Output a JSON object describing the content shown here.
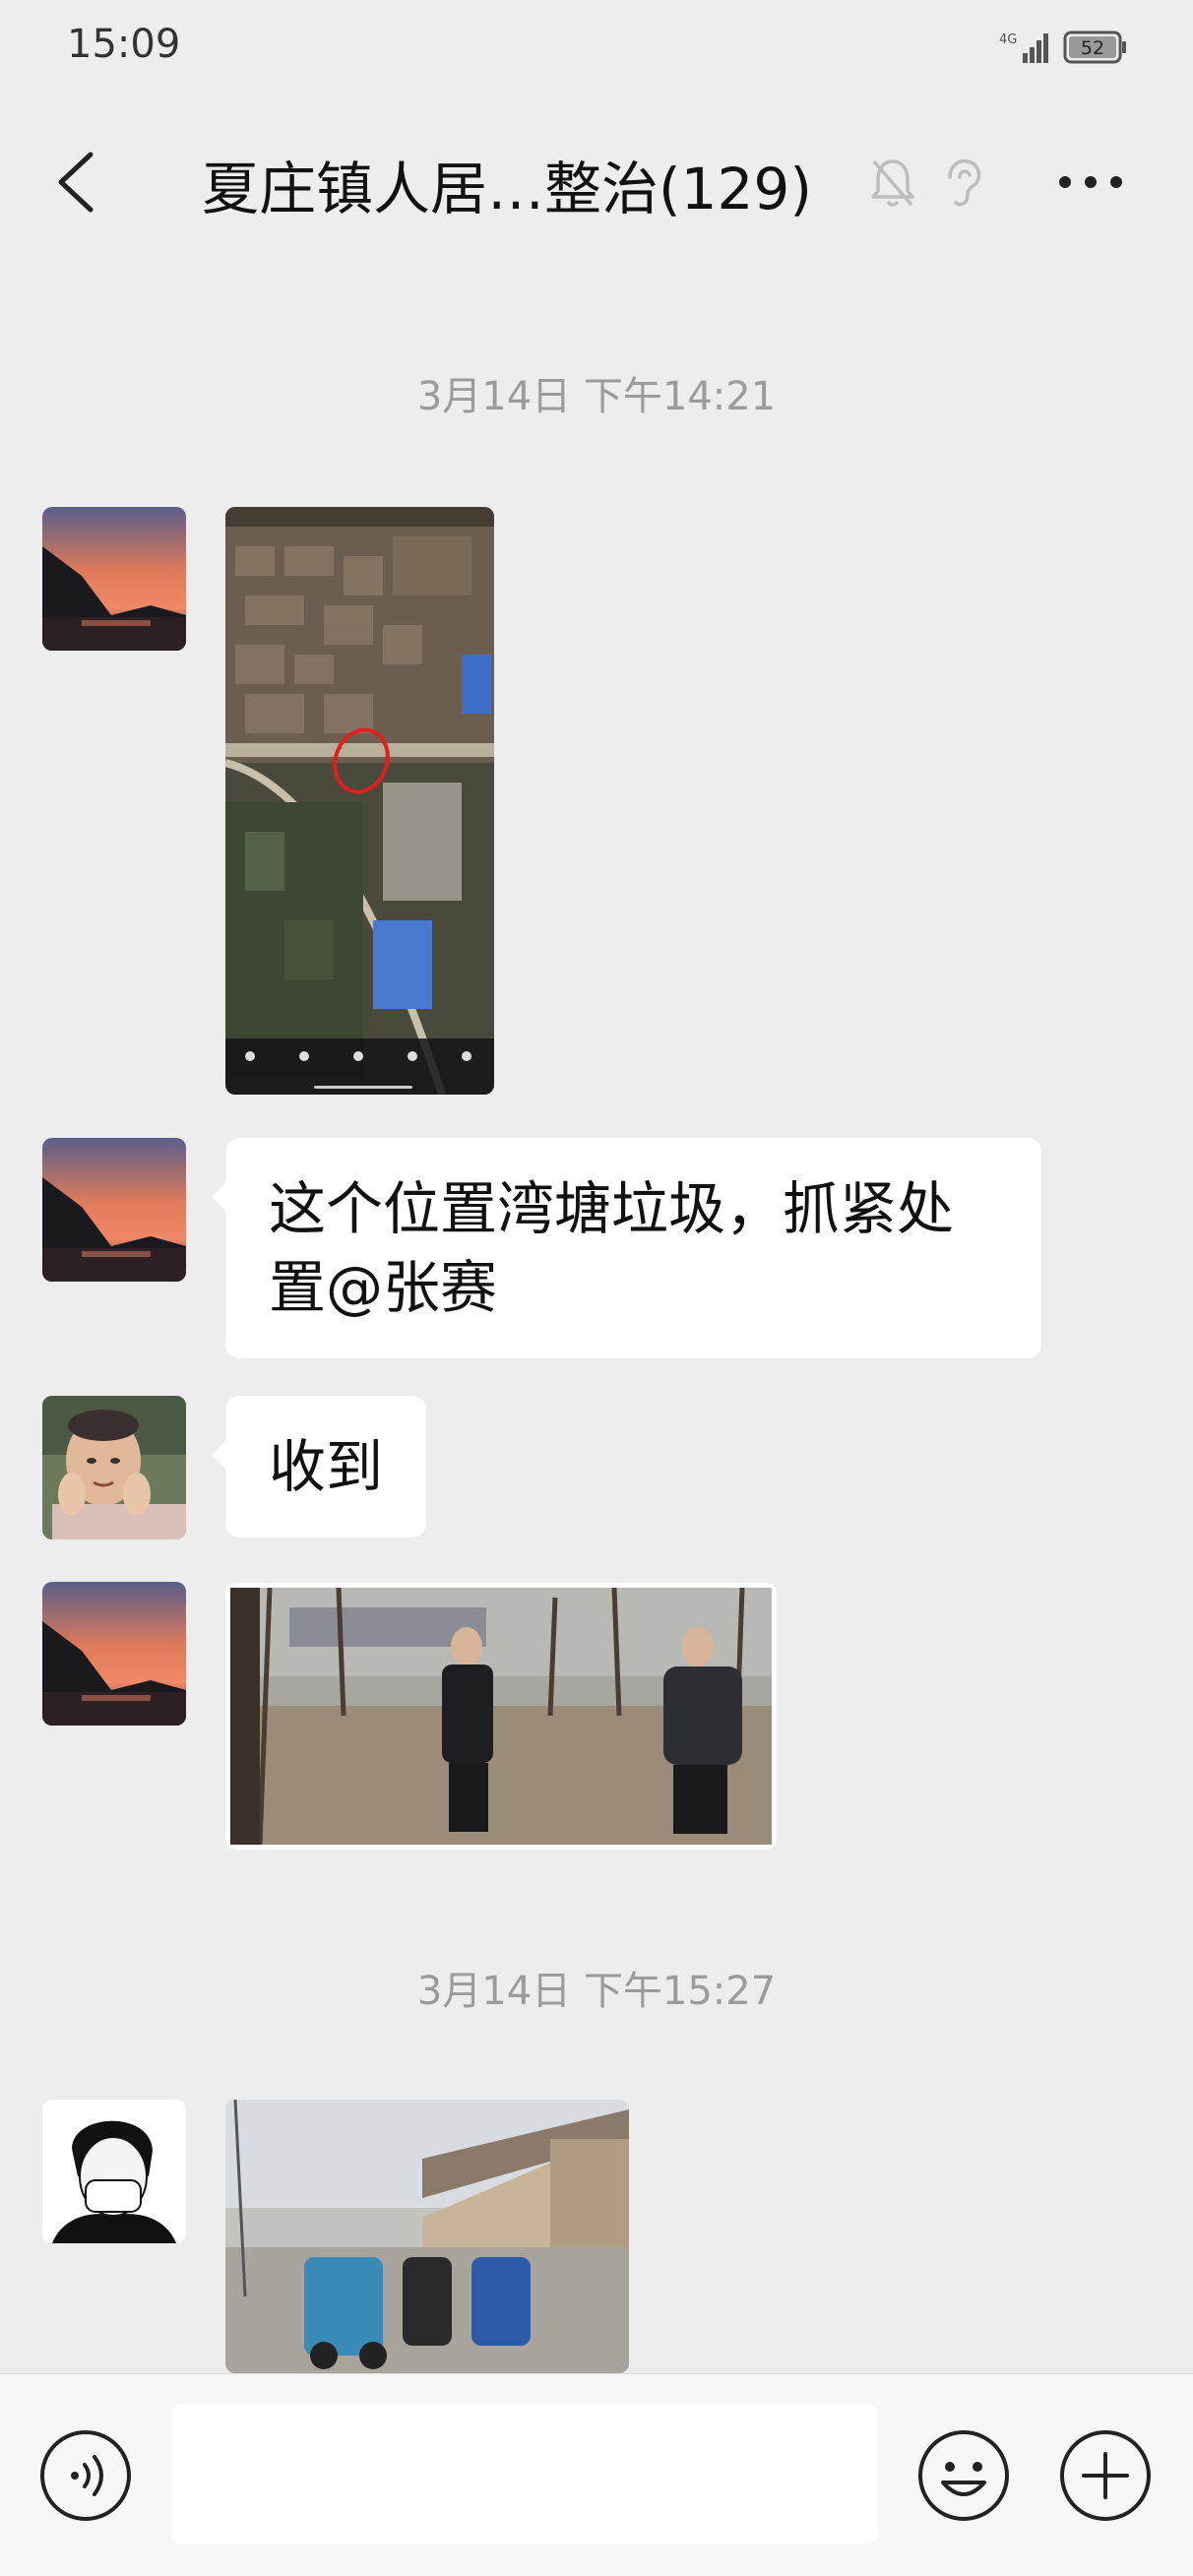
{
  "status_bar": {
    "time": "15:09",
    "network": "4G",
    "battery": "52"
  },
  "nav": {
    "title": "夏庄镇人居…整治(129)",
    "icons": [
      "back-icon",
      "mute-bell-icon",
      "ear-icon",
      "more-icon"
    ]
  },
  "messages": {
    "time1": "3月14日 下午14:21",
    "m2_text": "这个位置湾塘垃圾，抓紧处置@张赛",
    "m3_text": "收到",
    "time2": "3月14日 下午15:27"
  },
  "input_bar": {
    "value": "",
    "icons": [
      "voice-icon",
      "emoji-icon",
      "plus-icon"
    ]
  },
  "colors": {
    "background": "#ededed",
    "bubble": "#ffffff",
    "timestamp": "#9b9b9b",
    "input_bar": "#f7f7f7"
  }
}
